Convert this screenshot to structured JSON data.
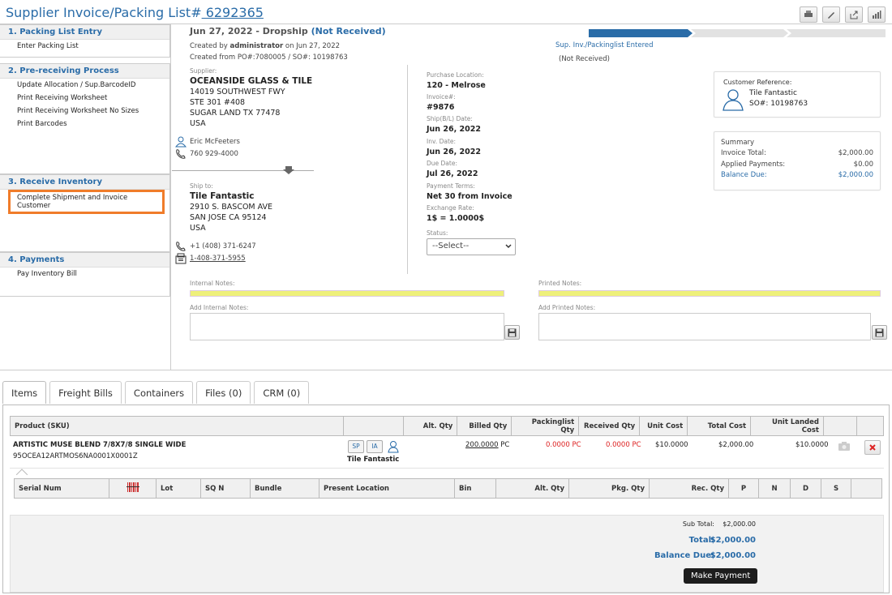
{
  "header": {
    "title_prefix": "Supplier Invoice/Packing List#",
    "number": " 6292365"
  },
  "sidebar": {
    "s1": {
      "title": "1. Packing List Entry",
      "items": [
        "Enter Packing List"
      ]
    },
    "s2": {
      "title": "2. Pre-receiving Process",
      "items": [
        "Update Allocation / Sup.BarcodeID",
        "Print Receiving Worksheet",
        "Print Receiving Worksheet No Sizes",
        "Print Barcodes"
      ]
    },
    "s3": {
      "title": "3. Receive Inventory",
      "items": [
        "Complete Shipment and Invoice Customer"
      ]
    },
    "s4": {
      "title": "4. Payments",
      "items": [
        "Pay Inventory Bill"
      ]
    }
  },
  "order": {
    "date_line": "Jun 27, 2022 - Dropship",
    "status": "(Not Received)",
    "created_by_label": "Created by",
    "created_by": "administrator",
    "created_on_label": "on",
    "created_on": "Jun 27, 2022",
    "created_from_label": "Created from",
    "created_from": "PO#:7080005 / SO#: 10198763"
  },
  "progress": {
    "step_label": "Sup. Inv./Packinglist Entered",
    "step_status": "(Not Received)",
    "color": "#2a6ca8"
  },
  "supplier": {
    "label": "Supplier:",
    "name": "OCEANSIDE GLASS & TILE",
    "addr1": "14019 SOUTHWEST FWY",
    "addr2": "STE 301 #408",
    "addr3": "SUGAR LAND TX 77478",
    "country": "USA",
    "contact": "Eric McFeeters",
    "phone": "760 929-4000"
  },
  "shipto": {
    "label": "Ship to:",
    "name": "Tile Fantastic",
    "addr1": "2910 S. BASCOM AVE",
    "addr2": "SAN JOSE CA 95124",
    "country": "USA",
    "phone": "+1 (408) 371-6247",
    "fax": "1-408-371-5955"
  },
  "details": {
    "purchase_location_label": "Purchase Location:",
    "purchase_location": "120 - Melrose",
    "invoice_label": "Invoice#:",
    "invoice": "#9876",
    "ship_label": "Ship(B/L) Date:",
    "ship": "Jun 26, 2022",
    "inv_date_label": "Inv. Date:",
    "inv_date": "Jun 26, 2022",
    "due_label": "Due Date:",
    "due": "Jul 26, 2022",
    "terms_label": "Payment Terms:",
    "terms": "Net 30 from Invoice",
    "rate_label": "Exchange Rate:",
    "rate": "1$  = 1.0000$",
    "status_label": "Status:",
    "status_value": "--Select--"
  },
  "customer_ref": {
    "label": "Customer Reference:",
    "name": "Tile Fantastic",
    "so": "SO#:  10198763"
  },
  "summary": {
    "title": "Summary",
    "invoice_total_label": "Invoice Total:",
    "invoice_total": "$2,000.00",
    "applied_label": "Applied Payments:",
    "applied": "$0.00",
    "balance_label": "Balance Due:",
    "balance": "$2,000.00"
  },
  "notes": {
    "internal_label": "Internal Notes:",
    "printed_label": "Printed Notes:",
    "add_internal_label": "Add Internal Notes:",
    "add_printed_label": "Add Printed Notes:"
  },
  "tabs": [
    "Items",
    "Freight Bills",
    "Containers",
    "Files (0)",
    "CRM (0)"
  ],
  "items_table": {
    "headers": [
      "Product (SKU)",
      "",
      "Alt. Qty",
      "Billed Qty",
      "Packinglist Qty",
      "Received Qty",
      "Unit Cost",
      "Total Cost",
      "Unit Landed Cost",
      "",
      ""
    ],
    "row": {
      "name": "ARTISTIC MUSE BLEND 7/8X7/8 SINGLE WIDE",
      "sku": "95OCEA12ARTMOS6NA0001X0001Z",
      "sp": "SP",
      "ia": "IA",
      "customer": "Tile Fantastic",
      "billed": "200.0000",
      "billed_unit": "PC",
      "packing": "0.0000 PC",
      "received": "0.0000 PC",
      "unit_cost": "$10.0000",
      "total_cost": "$2,000.00",
      "landed": "$10.0000"
    }
  },
  "serial_table": {
    "headers": [
      "Serial Num",
      "",
      "Lot",
      "SQ N",
      "Bundle",
      "Present Location",
      "Bin",
      "Alt. Qty",
      "Pkg. Qty",
      "Rec. Qty",
      "P",
      "N",
      "D",
      "S",
      ""
    ]
  },
  "totals": {
    "sub_label": "Sub Total:",
    "sub": "$2,000.00",
    "total_label": "Total:",
    "total": "$2,000.00",
    "balance_label": "Balance Due:",
    "balance": "$2,000.00",
    "make_payment": "Make Payment"
  }
}
